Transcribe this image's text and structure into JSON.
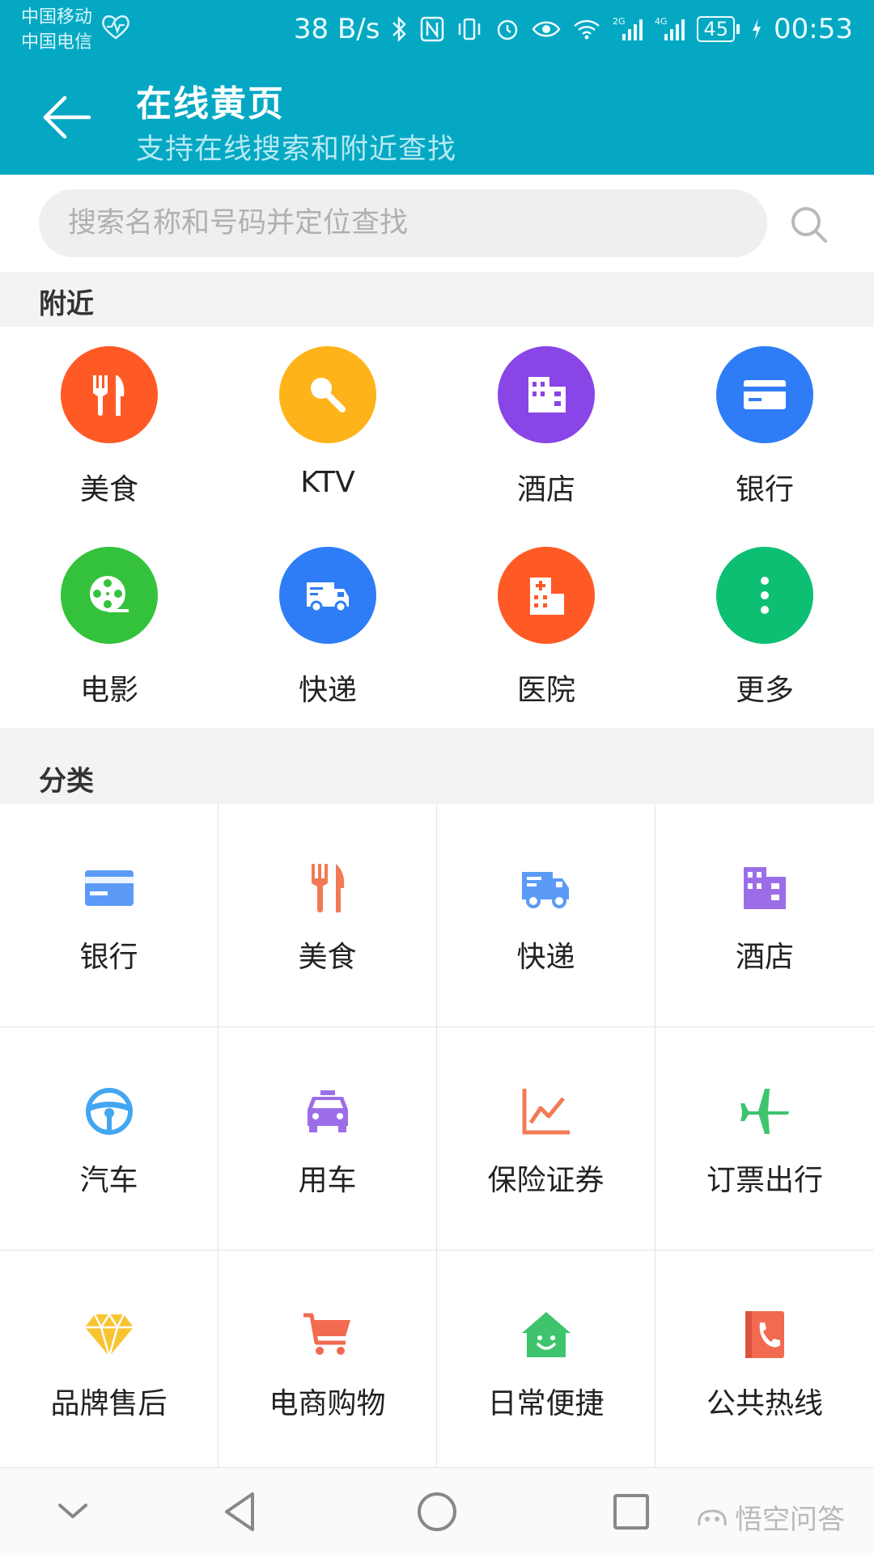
{
  "status_bar": {
    "carrier1": "中国移动",
    "carrier2": "中国电信",
    "net_speed": "38 B/s",
    "sig1_label": "2G",
    "sig2_label": "4G",
    "battery": "45",
    "time": "00:53"
  },
  "app_bar": {
    "title": "在线黄页",
    "subtitle": "支持在线搜索和附近查找"
  },
  "search": {
    "placeholder": "搜索名称和号码并定位查找"
  },
  "nearby": {
    "header": "附近",
    "items": [
      {
        "label": "美食",
        "color": "#ff5a26",
        "icon": "fork-knife-icon"
      },
      {
        "label": "KTV",
        "color": "#ffb31a",
        "icon": "microphone-icon"
      },
      {
        "label": "酒店",
        "color": "#8a45e6",
        "icon": "building-icon"
      },
      {
        "label": "银行",
        "color": "#2f7df6",
        "icon": "bank-card-icon"
      },
      {
        "label": "电影",
        "color": "#34c23c",
        "icon": "film-reel-icon"
      },
      {
        "label": "快递",
        "color": "#2f7df6",
        "icon": "delivery-truck-icon"
      },
      {
        "label": "医院",
        "color": "#ff5a26",
        "icon": "hospital-icon"
      },
      {
        "label": "更多",
        "color": "#0dbf73",
        "icon": "more-icon"
      }
    ]
  },
  "categories": {
    "header": "分类",
    "items": [
      {
        "label": "银行",
        "color": "#5b9bf7",
        "icon": "bank-card-icon"
      },
      {
        "label": "美食",
        "color": "#f27a55",
        "icon": "fork-knife-icon"
      },
      {
        "label": "快递",
        "color": "#5b9bf7",
        "icon": "delivery-truck-icon"
      },
      {
        "label": "酒店",
        "color": "#9b6ee8",
        "icon": "building-icon"
      },
      {
        "label": "汽车",
        "color": "#43a6f0",
        "icon": "steering-wheel-icon"
      },
      {
        "label": "用车",
        "color": "#9b6ee8",
        "icon": "taxi-icon"
      },
      {
        "label": "保险证券",
        "color": "#f27a55",
        "icon": "stock-chart-icon"
      },
      {
        "label": "订票出行",
        "color": "#3ec46d",
        "icon": "airplane-icon"
      },
      {
        "label": "品牌售后",
        "color": "#f7c532",
        "icon": "diamond-icon"
      },
      {
        "label": "电商购物",
        "color": "#f26a4f",
        "icon": "shopping-cart-icon"
      },
      {
        "label": "日常便捷",
        "color": "#3ec46d",
        "icon": "home-smile-icon"
      },
      {
        "label": "公共热线",
        "color": "#f26a4f",
        "icon": "phone-book-icon"
      }
    ]
  },
  "watermark": "悟空问答"
}
